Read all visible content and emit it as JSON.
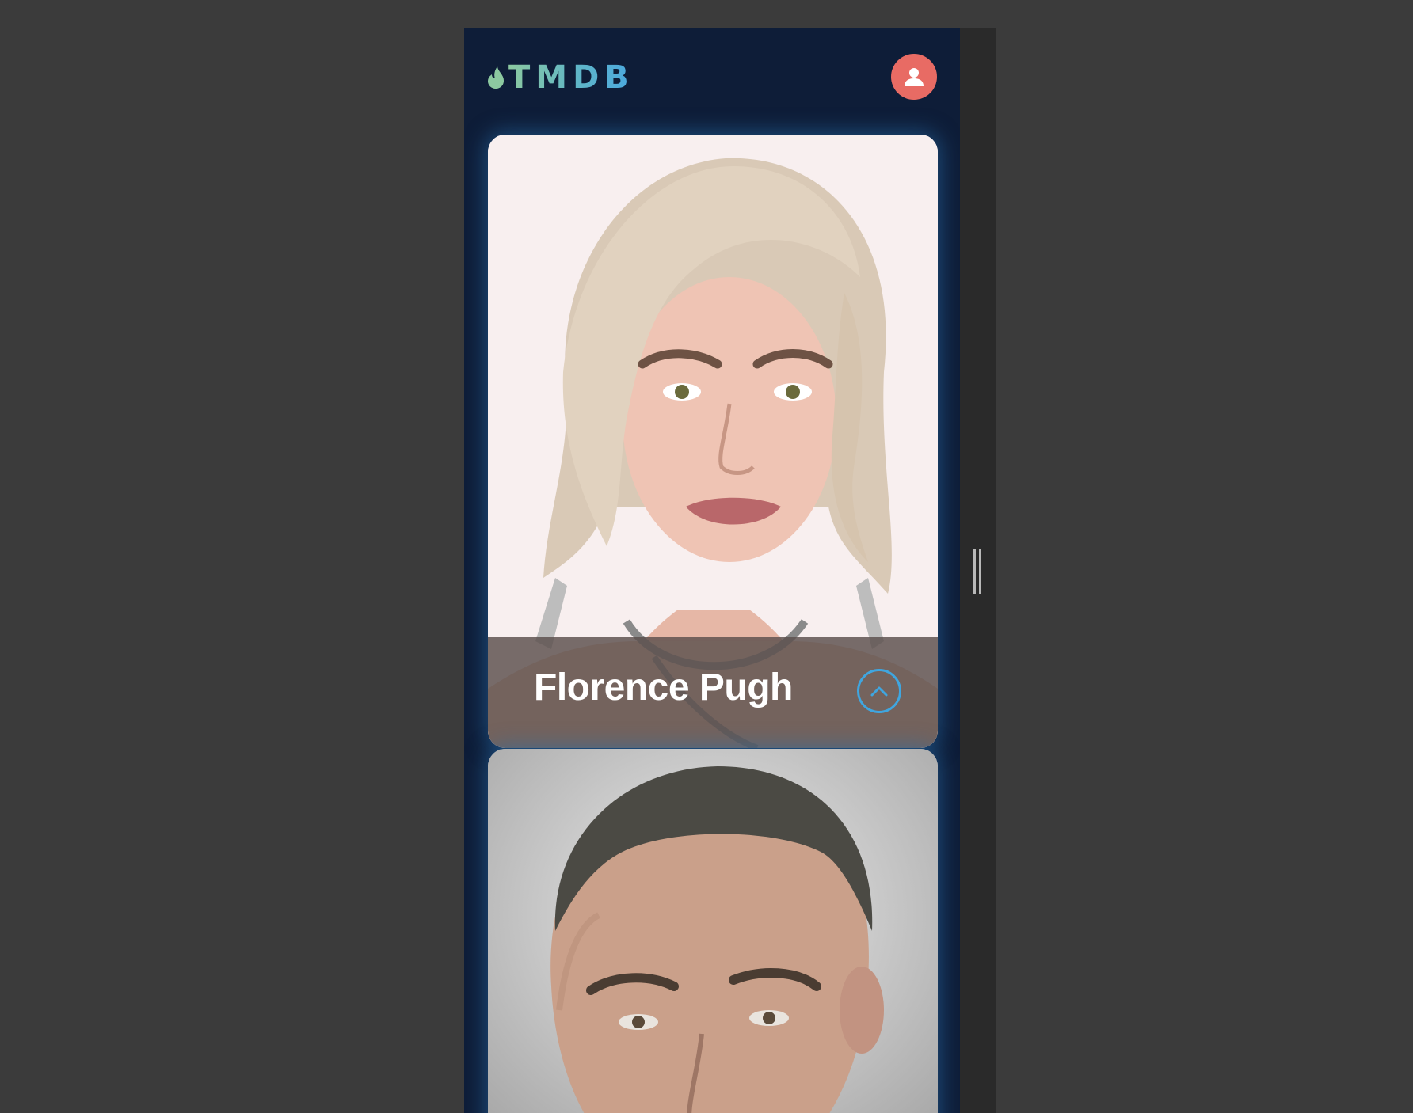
{
  "app": {
    "logo_text": "TMDB",
    "logo_icon": "flame-icon",
    "profile_icon": "user-icon"
  },
  "colors": {
    "background": "#3b3b3b",
    "app_background": "#0e1d38",
    "avatar": "#e86b64",
    "accent": "#3fa6e0",
    "logo_gradient": [
      "#8cc9a0",
      "#4aa8e0"
    ]
  },
  "cards": [
    {
      "name": "Florence Pugh",
      "expand_icon": "chevron-up-icon"
    },
    {
      "name": ""
    }
  ]
}
